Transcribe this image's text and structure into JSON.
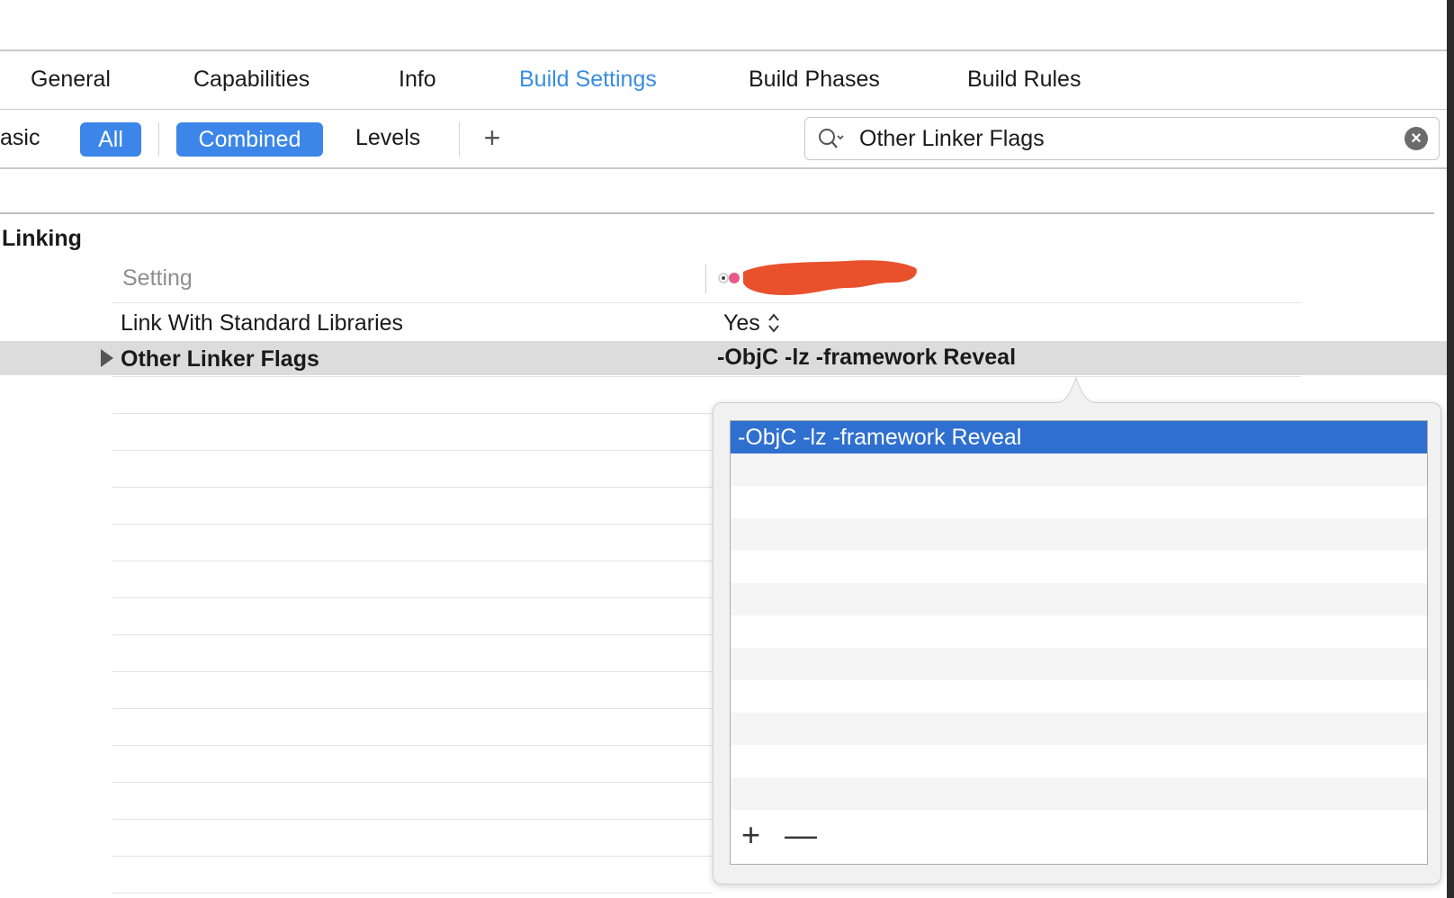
{
  "tabs": [
    {
      "label": "General"
    },
    {
      "label": "Capabilities"
    },
    {
      "label": "Info"
    },
    {
      "label": "Build Settings"
    },
    {
      "label": "Build Phases"
    },
    {
      "label": "Build Rules"
    }
  ],
  "filter_bar": {
    "basic_label": "asic",
    "all_label": "All",
    "combined_label": "Combined",
    "levels_label": "Levels",
    "add_label": "+"
  },
  "search": {
    "value": "Other Linker Flags",
    "icon": "search-icon",
    "clear_icon": "clear-icon",
    "clear_symbol": "×"
  },
  "section": {
    "title": "Linking",
    "header_setting": "Setting"
  },
  "rows": [
    {
      "name": "Link With Standard Libraries",
      "value": "Yes"
    },
    {
      "name": "Other Linker Flags",
      "value": "-ObjC -lz -framework Reveal"
    }
  ],
  "popover": {
    "items": [
      "-ObjC -lz -framework Reveal"
    ],
    "add_label": "+",
    "remove_label": "—"
  },
  "colors": {
    "accent": "#3a8ddf",
    "pill": "#3b86e8",
    "selection": "#2f6fd0",
    "redaction": "#e8512b"
  }
}
